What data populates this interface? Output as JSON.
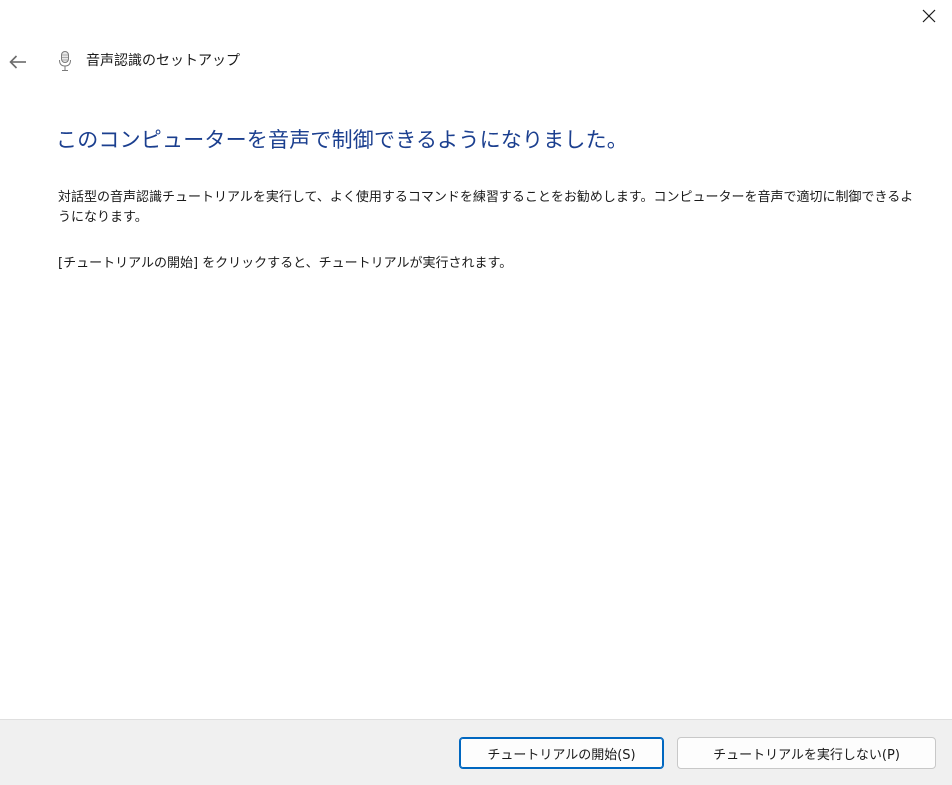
{
  "window": {
    "title": "音声認識のセットアップ",
    "close_icon": "close-icon",
    "back_icon": "back-arrow-icon",
    "app_icon": "microphone-icon"
  },
  "content": {
    "heading": "このコンピューターを音声で制御できるようになりました。",
    "description": "対話型の音声認識チュートリアルを実行して、よく使用するコマンドを練習することをお勧めします。コンピューターを音声で適切に制御できるようになります。",
    "instruction": "[チュートリアルの開始] をクリックすると、チュートリアルが実行されます。"
  },
  "footer": {
    "start_button": "チュートリアルの開始(S)",
    "skip_button": "チュートリアルを実行しない(P)"
  },
  "colors": {
    "heading": "#1b3f8f",
    "primary_border": "#0067c0",
    "footer_bg": "#f0f0f0"
  }
}
